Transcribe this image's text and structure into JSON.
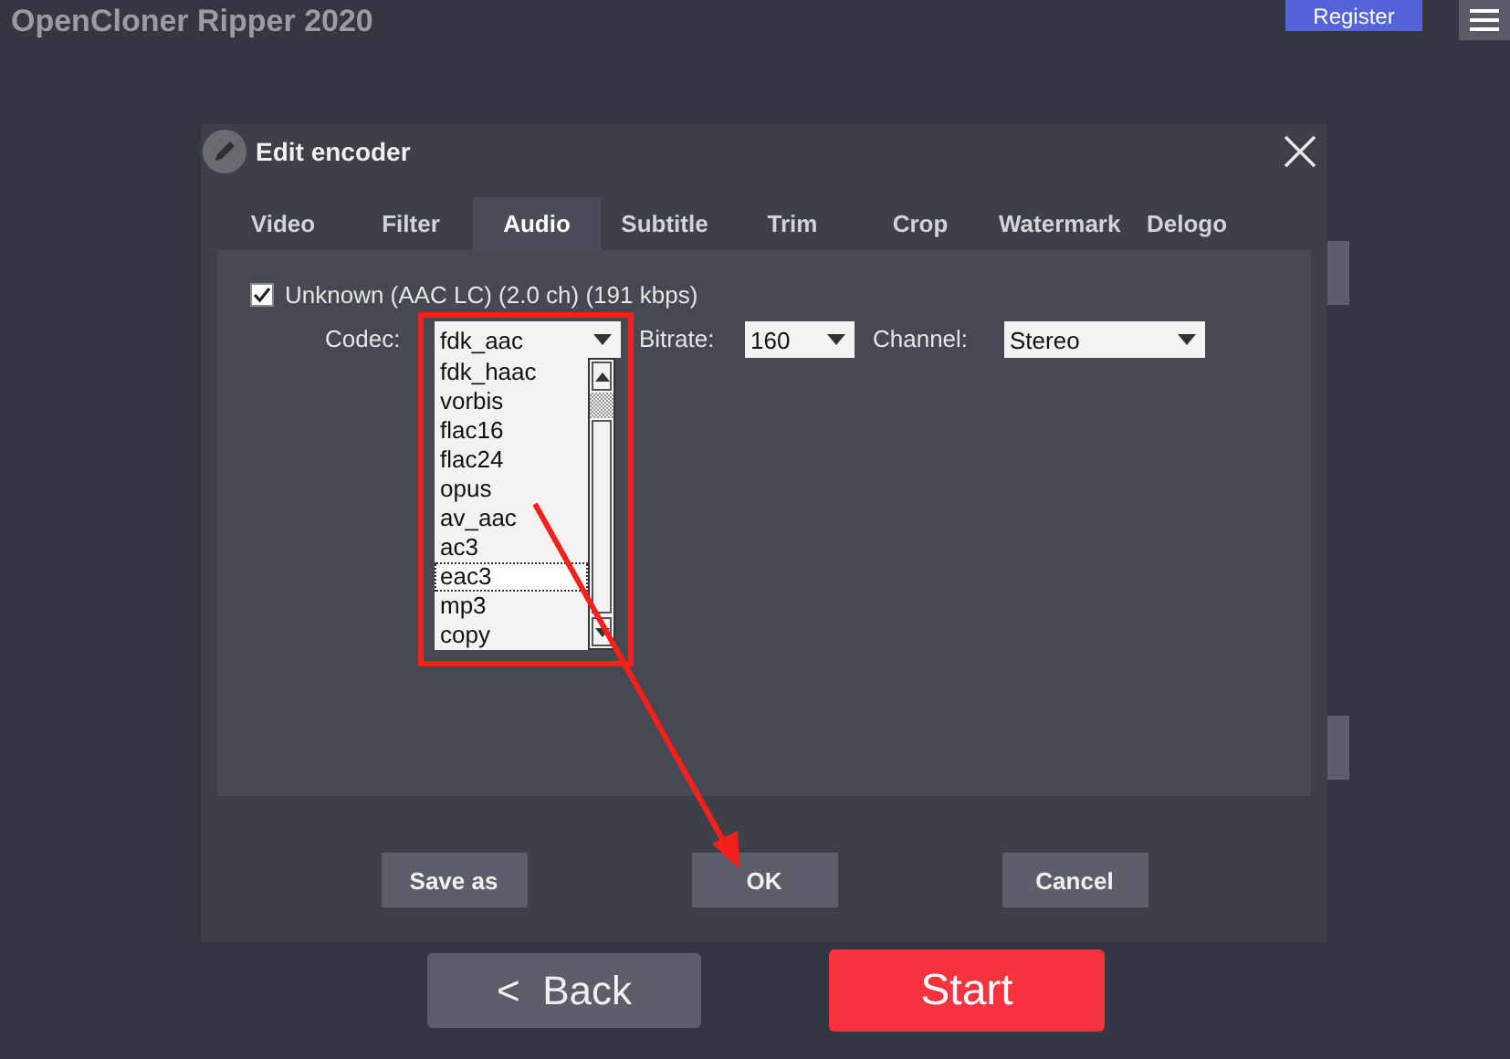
{
  "app": {
    "title": "OpenCloner Ripper 2020",
    "register": "Register"
  },
  "dialog": {
    "title": "Edit encoder",
    "tabs": [
      {
        "label": "Video",
        "selected": false
      },
      {
        "label": "Filter",
        "selected": false
      },
      {
        "label": "Audio",
        "selected": true
      },
      {
        "label": "Subtitle",
        "selected": false
      },
      {
        "label": "Trim",
        "selected": false
      },
      {
        "label": "Crop",
        "selected": false
      },
      {
        "label": "Watermark",
        "selected": false
      },
      {
        "label": "Delogo",
        "selected": false
      }
    ],
    "track": {
      "label": "Unknown (AAC LC) (2.0 ch) (191 kbps)",
      "checked": true
    },
    "codec": {
      "label": "Codec:",
      "value": "fdk_aac",
      "options": [
        {
          "label": "fdk_haac",
          "selected": false
        },
        {
          "label": "vorbis",
          "selected": false
        },
        {
          "label": "flac16",
          "selected": false
        },
        {
          "label": "flac24",
          "selected": false
        },
        {
          "label": "opus",
          "selected": false
        },
        {
          "label": "av_aac",
          "selected": false
        },
        {
          "label": "ac3",
          "selected": false
        },
        {
          "label": "eac3",
          "selected": true
        },
        {
          "label": "mp3",
          "selected": false
        },
        {
          "label": "copy",
          "selected": false
        }
      ]
    },
    "bitrate": {
      "label": "Bitrate:",
      "value": "160"
    },
    "channel": {
      "label": "Channel:",
      "value": "Stereo"
    },
    "buttons": [
      "Save as",
      "OK",
      "Cancel"
    ]
  },
  "footer": {
    "back": "<  Back",
    "start": "Start"
  }
}
